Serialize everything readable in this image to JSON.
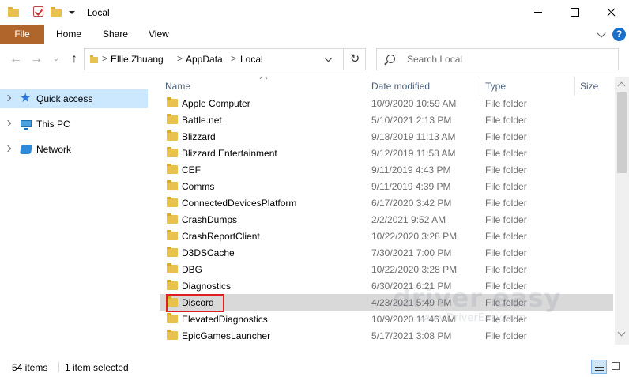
{
  "window": {
    "title": "Local"
  },
  "ribbon": {
    "tabs": [
      "File",
      "Home",
      "Share",
      "View"
    ],
    "help_label": "?"
  },
  "address": {
    "crumbs": [
      "Ellie.Zhuang",
      "AppData",
      "Local"
    ],
    "separator": ">"
  },
  "search": {
    "placeholder": "Search Local"
  },
  "sidebar": {
    "items": [
      {
        "label": "Quick access",
        "icon": "star-icon",
        "selected": true
      },
      {
        "label": "This PC",
        "icon": "computer-icon",
        "selected": false
      },
      {
        "label": "Network",
        "icon": "network-icon",
        "selected": false
      }
    ]
  },
  "columns": {
    "name": "Name",
    "date": "Date modified",
    "type": "Type",
    "size": "Size"
  },
  "rows": [
    {
      "name": "Apple Computer",
      "date": "10/9/2020 10:59 AM",
      "type": "File folder"
    },
    {
      "name": "Battle.net",
      "date": "5/10/2021 2:13 PM",
      "type": "File folder"
    },
    {
      "name": "Blizzard",
      "date": "9/18/2019 11:13 AM",
      "type": "File folder"
    },
    {
      "name": "Blizzard Entertainment",
      "date": "9/12/2019 11:58 AM",
      "type": "File folder"
    },
    {
      "name": "CEF",
      "date": "9/11/2019 4:43 PM",
      "type": "File folder"
    },
    {
      "name": "Comms",
      "date": "9/11/2019 4:39 PM",
      "type": "File folder"
    },
    {
      "name": "ConnectedDevicesPlatform",
      "date": "6/17/2020 3:42 PM",
      "type": "File folder"
    },
    {
      "name": "CrashDumps",
      "date": "2/2/2021 9:52 AM",
      "type": "File folder"
    },
    {
      "name": "CrashReportClient",
      "date": "10/22/2020 3:28 PM",
      "type": "File folder"
    },
    {
      "name": "D3DSCache",
      "date": "7/30/2021 7:00 PM",
      "type": "File folder"
    },
    {
      "name": "DBG",
      "date": "10/22/2020 3:28 PM",
      "type": "File folder"
    },
    {
      "name": "Diagnostics",
      "date": "6/30/2021 6:21 PM",
      "type": "File folder"
    },
    {
      "name": "Discord",
      "date": "4/23/2021 5:49 PM",
      "type": "File folder",
      "selected": true
    },
    {
      "name": "ElevatedDiagnostics",
      "date": "10/9/2020 11:46 AM",
      "type": "File folder"
    },
    {
      "name": "EpicGamesLauncher",
      "date": "5/17/2021 3:08 PM",
      "type": "File folder"
    }
  ],
  "status": {
    "items": "54 items",
    "selected": "1 item selected"
  },
  "watermark": {
    "brand": "driver easy",
    "url": "www.DriverEasy.com"
  },
  "colors": {
    "file_tab": "#b0652a",
    "selection": "#cce8ff",
    "row_selected": "#d9d9d9",
    "highlight": "#e02020"
  }
}
